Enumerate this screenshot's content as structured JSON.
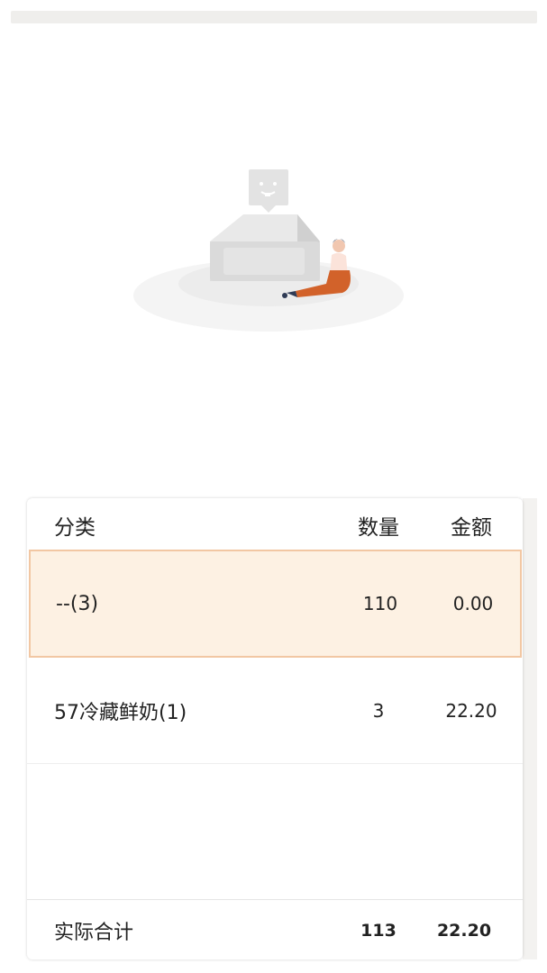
{
  "empty_state": {
    "illustration": "empty-box-with-sitting-person"
  },
  "table": {
    "headers": {
      "category": "分类",
      "quantity": "数量",
      "amount": "金额"
    },
    "rows": [
      {
        "category": "--(3)",
        "quantity": "110",
        "amount": "0.00",
        "highlighted": true
      },
      {
        "category": "57冷藏鲜奶(1)",
        "quantity": "3",
        "amount": "22.20",
        "highlighted": false
      }
    ],
    "total": {
      "label": "实际合计",
      "quantity": "113",
      "amount": "22.20"
    }
  },
  "colors": {
    "highlight_bg": "#fdf1e3",
    "highlight_border": "#f2c7a3",
    "person_pants": "#d2622a"
  }
}
